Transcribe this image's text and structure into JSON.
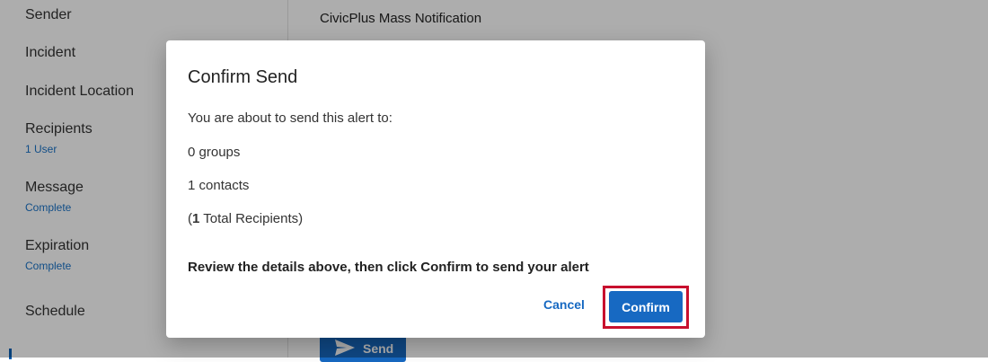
{
  "sidebar": {
    "items": [
      {
        "label": "Sender",
        "sub": ""
      },
      {
        "label": "Incident",
        "sub": ""
      },
      {
        "label": "Incident Location",
        "sub": ""
      },
      {
        "label": "Recipients",
        "sub": "1 User"
      },
      {
        "label": "Message",
        "sub": "Complete"
      },
      {
        "label": "Expiration",
        "sub": "Complete"
      },
      {
        "label": "Schedule",
        "sub": ""
      }
    ]
  },
  "main": {
    "sender_value": "CivicPlus Mass Notification",
    "send_label": "Send"
  },
  "dialog": {
    "title": "Confirm Send",
    "intro": "You are about to send this alert to:",
    "groups": "0 groups",
    "contacts": "1 contacts",
    "total_open": "(",
    "total_count": "1",
    "total_rest": " Total Recipients)",
    "review": "Review the details above, then click Confirm to send your alert",
    "cancel_label": "Cancel",
    "confirm_label": "Confirm"
  },
  "colors": {
    "accent": "#1769c2",
    "highlight": "#c8102e",
    "link": "#1a73c8"
  },
  "icons": {
    "send": "paper-plane-icon"
  }
}
